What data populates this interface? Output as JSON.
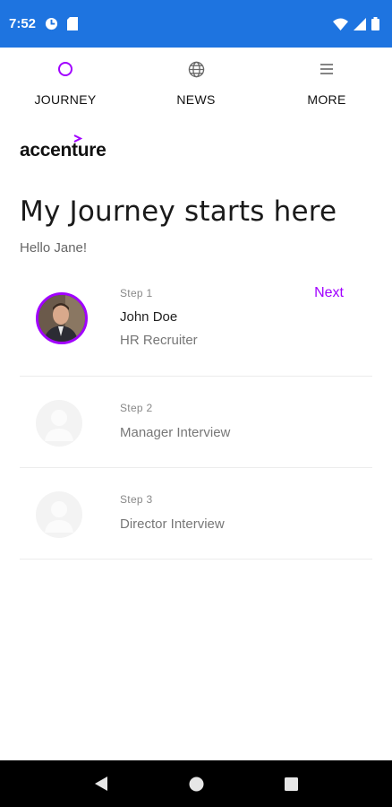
{
  "status_bar": {
    "time": "7:52",
    "icons_left": [
      "data-saver-icon",
      "sd-card-icon"
    ],
    "icons_right": [
      "wifi-icon",
      "signal-icon",
      "battery-icon"
    ],
    "background_color": "#1e74e0"
  },
  "nav": {
    "tabs": [
      {
        "label": "JOURNEY",
        "icon": "circle-icon",
        "active": true
      },
      {
        "label": "NEWS",
        "icon": "globe-icon",
        "active": false
      },
      {
        "label": "MORE",
        "icon": "menu-icon",
        "active": false
      }
    ]
  },
  "logo": {
    "text": "accenture",
    "accent_color": "#a100ff"
  },
  "page": {
    "title": "My Journey starts here",
    "greeting": "Hello Jane!"
  },
  "steps": [
    {
      "step": "Step 1",
      "name": "John Doe",
      "role": "HR Recruiter",
      "action": "Next",
      "active": true
    },
    {
      "step": "Step 2",
      "role": "Manager Interview",
      "active": false
    },
    {
      "step": "Step 3",
      "role": "Director Interview",
      "active": false
    }
  ],
  "accent_color": "#a100ff",
  "system_nav": [
    "back-icon",
    "home-icon",
    "recents-icon"
  ]
}
